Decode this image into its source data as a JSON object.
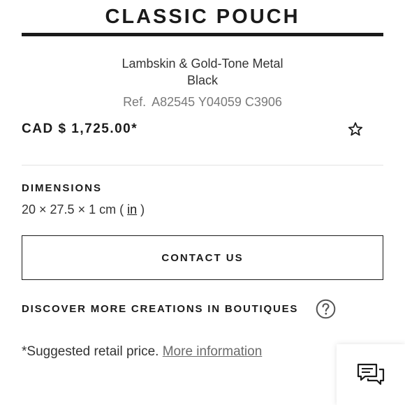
{
  "product": {
    "title": "CLASSIC POUCH",
    "material": "Lambskin & Gold-Tone Metal",
    "color": "Black",
    "ref_label": "Ref.",
    "ref_code": "A82545 Y04059 C3906",
    "price": "CAD $ 1,725.00*"
  },
  "dimensions": {
    "heading": "DIMENSIONS",
    "value": "20 × 27.5 × 1 cm",
    "open_paren": "(",
    "unit_link": "in",
    "close_paren": ")"
  },
  "actions": {
    "contact_label": "CONTACT US",
    "discover_label": "DISCOVER MORE CREATIONS IN BOUTIQUES"
  },
  "footnote": {
    "text": "*Suggested retail price.",
    "link": "More information"
  },
  "icons": {
    "wishlist": "star-icon",
    "help": "question-icon",
    "chat": "chat-icon"
  },
  "colors": {
    "text": "#1a1a1a",
    "muted": "#7a7a7a",
    "divider": "#e2e2e2",
    "background": "#ffffff"
  }
}
